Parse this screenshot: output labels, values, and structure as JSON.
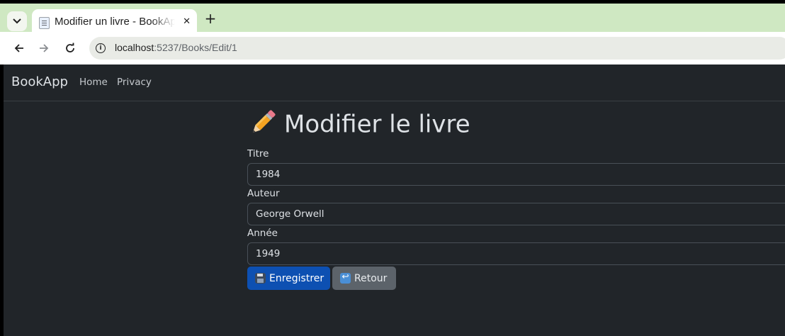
{
  "browser": {
    "tab_title": "Modifier un livre - BookApp",
    "url_host": "localhost",
    "url_path": ":5237/Books/Edit/1"
  },
  "navbar": {
    "brand": "BookApp",
    "links": [
      "Home",
      "Privacy"
    ]
  },
  "form": {
    "heading": "Modifier le livre",
    "fields": [
      {
        "label": "Titre",
        "value": "1984"
      },
      {
        "label": "Auteur",
        "value": "George Orwell"
      },
      {
        "label": "Année",
        "value": "1949"
      }
    ],
    "save_label": "Enregistrer",
    "back_label": "Retour"
  },
  "icons": {
    "heading": "pencil-icon",
    "save": "floppy-disk-icon",
    "back": "return-arrow-icon"
  },
  "colors": {
    "page_bg": "#212529",
    "primary": "#0d50b2",
    "secondary": "#5c636a"
  }
}
